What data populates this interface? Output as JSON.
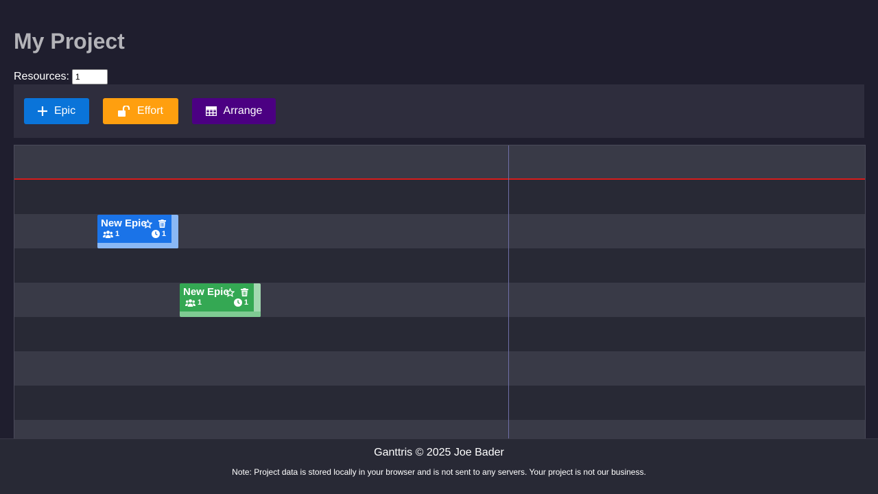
{
  "project": {
    "title": "My Project"
  },
  "resources": {
    "label": "Resources:",
    "value": "1"
  },
  "toolbar": {
    "epic_label": "Epic",
    "effort_label": "Effort",
    "arrange_label": "Arrange"
  },
  "colors": {
    "epic_button": "#0a74d9",
    "effort_button": "#ff9f0f",
    "arrange_button": "#4b0082",
    "today_line": "#d81b1b"
  },
  "epics": [
    {
      "name": "New Epic",
      "resources": "1",
      "effort": "1",
      "color": "blue"
    },
    {
      "name": "New Epic",
      "resources": "1",
      "effort": "1",
      "color": "green"
    }
  ],
  "footer": {
    "copyright": "Ganttris © 2025 Joe Bader",
    "note": "Note: Project data is stored locally in your browser and is not sent to any servers. Your project is not our business."
  }
}
